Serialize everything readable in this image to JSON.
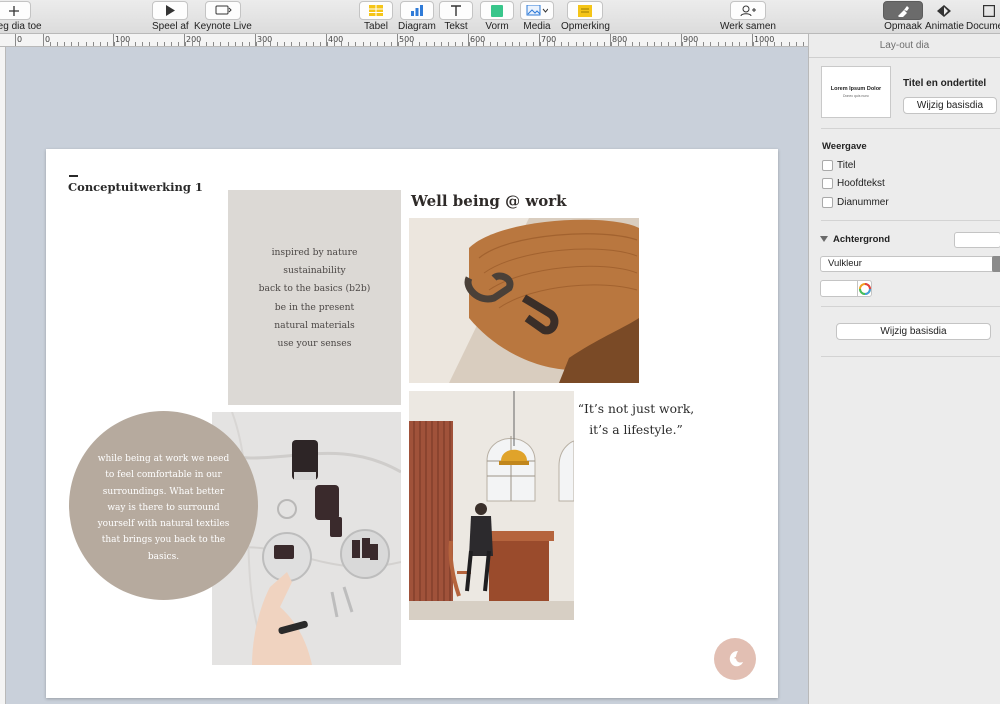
{
  "toolbar": {
    "add_slide": "Voeg dia toe",
    "play": "Speel af",
    "keynote_live": "Keynote Live",
    "table": "Tabel",
    "chart": "Diagram",
    "text": "Tekst",
    "shape": "Vorm",
    "media": "Media",
    "comment": "Opmerking",
    "collaborate": "Werk samen",
    "format": "Opmaak",
    "animate": "Animatie",
    "document": "Document"
  },
  "ruler": {
    "labels": [
      "0",
      "0",
      "100",
      "200",
      "300",
      "400",
      "500",
      "600",
      "700",
      "800",
      "900",
      "1000"
    ]
  },
  "slide": {
    "concept_title": "Conceptuitwerking 1",
    "keywords": [
      "inspired by nature",
      "sustainability",
      "back to the basics (b2b)",
      "be in the present",
      "natural materials",
      "use your senses"
    ],
    "wellbeing_title": "Well being @ work",
    "circle_text": "while being at work we need to feel comfortable in our surroundings. What better way is there to surround yourself with natural textiles that brings you back to the basics.",
    "quote_line1": "“It’s not just work,",
    "quote_line2": "it’s a lifestyle.”",
    "logo_icon": "moon-leaf-logo-icon",
    "colors": {
      "keyword_bg": "#dcd9d5",
      "circle_bg": "#b6aa9e",
      "logo_bg": "#e2bfb3"
    }
  },
  "inspector": {
    "header": "Lay-out dia",
    "thumb_title": "Lorem Ipsum Dolor",
    "thumb_subtitle": "Donec quis nunc",
    "layout_name": "Titel en ondertitel",
    "change_master": "Wijzig basisdia",
    "view_section": "Weergave",
    "checks": [
      "Titel",
      "Hoofdtekst",
      "Dianummer"
    ],
    "background_section": "Achtergrond",
    "fill_value": "Vulkleur",
    "change_master_bottom": "Wijzig basisdia"
  }
}
